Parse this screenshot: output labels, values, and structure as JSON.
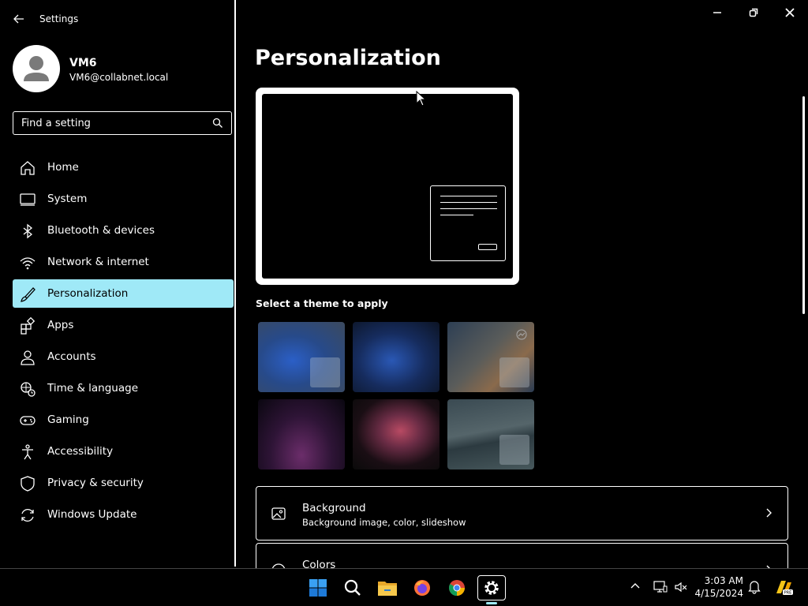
{
  "window": {
    "app_title": "Settings",
    "controls": {
      "minimize": "minimize-icon",
      "restore": "restore-icon",
      "close": "close-icon"
    }
  },
  "user": {
    "name": "VM6",
    "email": "VM6@collabnet.local"
  },
  "search": {
    "placeholder": "Find a setting"
  },
  "nav": {
    "items": [
      {
        "label": "Home",
        "icon": "home-icon"
      },
      {
        "label": "System",
        "icon": "laptop-icon"
      },
      {
        "label": "Bluetooth & devices",
        "icon": "bluetooth-icon"
      },
      {
        "label": "Network & internet",
        "icon": "wifi-icon"
      },
      {
        "label": "Personalization",
        "icon": "brush-icon",
        "active": true
      },
      {
        "label": "Apps",
        "icon": "apps-icon"
      },
      {
        "label": "Accounts",
        "icon": "person-icon"
      },
      {
        "label": "Time & language",
        "icon": "globe-clock-icon"
      },
      {
        "label": "Gaming",
        "icon": "gamepad-icon"
      },
      {
        "label": "Accessibility",
        "icon": "accessibility-icon"
      },
      {
        "label": "Privacy & security",
        "icon": "shield-icon"
      },
      {
        "label": "Windows Update",
        "icon": "sync-icon"
      }
    ]
  },
  "main": {
    "title": "Personalization",
    "themes_label": "Select a theme to apply",
    "cards": [
      {
        "title": "Background",
        "subtitle": "Background image, color, slideshow",
        "icon": "image-icon"
      },
      {
        "title": "Colors",
        "subtitle": "",
        "icon": "palette-icon"
      }
    ]
  },
  "taskbar": {
    "apps": [
      "windows-start-icon",
      "search-icon",
      "file-explorer-icon",
      "firefox-icon",
      "chrome-icon",
      "settings-icon"
    ],
    "clock": {
      "time": "3:03 AM",
      "date": "4/15/2024"
    }
  },
  "colors": {
    "accent": "#9fe9f7",
    "background": "#000000",
    "foreground": "#ffffff"
  }
}
